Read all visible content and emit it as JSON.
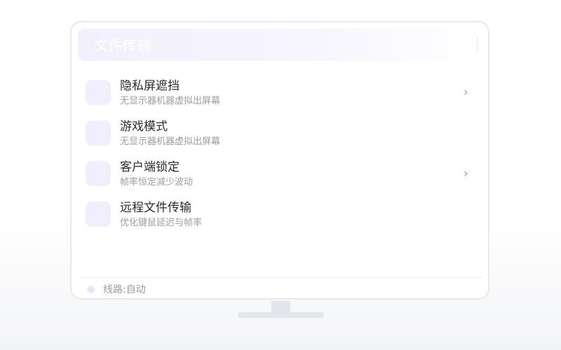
{
  "header": {
    "title": "文件传输"
  },
  "menu": {
    "items": [
      {
        "title": "隐私屏遮挡",
        "subtitle": "无显示器机器虚拟出屏幕",
        "chevron": "›"
      },
      {
        "title": "游戏模式",
        "subtitle": "无显示器机器虚拟出屏幕"
      },
      {
        "title": "客户端锁定",
        "subtitle": "帧率恒定减少波动",
        "chevron": "›"
      },
      {
        "title": "远程文件传输",
        "subtitle": "优化键鼠延迟与帧率"
      }
    ]
  },
  "footer": {
    "status": "线路:自动"
  },
  "colors": {
    "accent_light": "#f1eefd",
    "text_primary": "#2a2a30",
    "text_secondary": "#9a9ca6",
    "monitor_border": "#e8e9ec"
  },
  "icons": {
    "item": "feature-icon",
    "chevron": "chevron-right-icon",
    "status": "status-dot-icon"
  }
}
